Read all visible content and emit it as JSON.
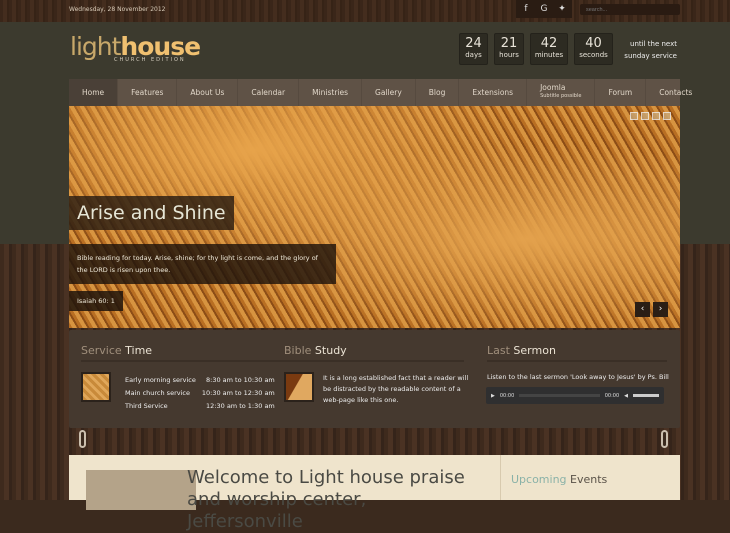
{
  "topbar": {
    "date": "Wednesday, 28 November 2012",
    "social": [
      {
        "icon": "facebook-icon",
        "glyph": "f"
      },
      {
        "icon": "google-icon",
        "glyph": "G"
      },
      {
        "icon": "twitter-icon",
        "glyph": "✦"
      }
    ],
    "search_placeholder": "search..."
  },
  "logo": {
    "light": "light",
    "house": "house",
    "sub": "CHURCH EDITION"
  },
  "countdown": [
    {
      "n": "24",
      "u": "days"
    },
    {
      "n": "21",
      "u": "hours"
    },
    {
      "n": "42",
      "u": "minutes"
    },
    {
      "n": "40",
      "u": "seconds"
    }
  ],
  "until": "until the next sunday service",
  "nav": [
    "Home",
    "Features",
    "About Us",
    "Calendar",
    "Ministries",
    "Gallery",
    "Blog",
    "Extensions",
    "Joomla",
    "Forum",
    "Contacts"
  ],
  "nav_sub": "Subtitle possible",
  "slider": {
    "title": "Arise and Shine",
    "text": "Bible reading for today. Arise, shine; for thy light is come, and the glory of the LORD is risen upon thee.",
    "ref": "Isaiah 60: 1",
    "prev": "‹",
    "next": "›"
  },
  "service": {
    "h1": "Service",
    "h2": "Time",
    "rows": [
      [
        "Early morning service",
        "8:30 am to 10:30 am"
      ],
      [
        "Main church service",
        "10:30 am to 12:30 am"
      ],
      [
        "Third Service",
        "12:30 am to 1:30 am"
      ]
    ]
  },
  "bible": {
    "h1": "Bible",
    "h2": "Study",
    "text": "It is a long established fact that a reader will be distracted by the readable content of a web-page like this one."
  },
  "sermon": {
    "h1": "Last",
    "h2": "Sermon",
    "text": "Listen to the last sermon 'Look away to Jesus' by Ps. Bill",
    "time_start": "00:00",
    "time_end": "00:00"
  },
  "welcome": "Welcome to Light house praise and worship center, Jeffersonville",
  "events": {
    "h1": "Upcoming",
    "h2": "Events"
  }
}
